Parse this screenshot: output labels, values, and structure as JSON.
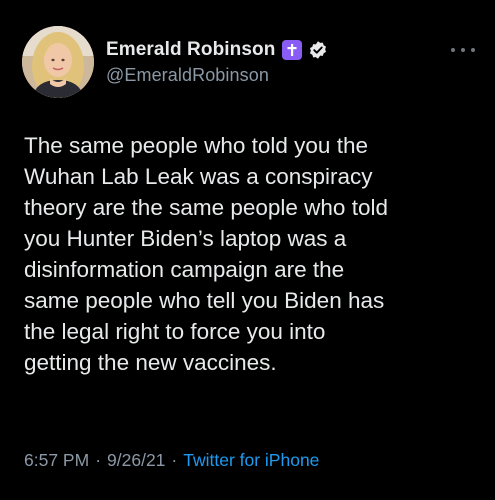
{
  "author": {
    "display_name": "Emerald Robinson",
    "handle": "@EmeraldRobinson",
    "badge_icons": [
      "cross-icon",
      "verified-icon"
    ]
  },
  "tweet": {
    "text": "The same people who told you the\nWuhan Lab Leak was a conspiracy\ntheory are the same people who told\nyou Hunter Biden’s laptop was a\ndisinformation campaign are the\nsame people who tell you Biden has\nthe legal right to force you into\ngetting the new vaccines."
  },
  "meta": {
    "time": "6:57 PM",
    "separator": "·",
    "date": "9/26/21",
    "source": "Twitter for iPhone"
  },
  "colors": {
    "background": "#000000",
    "text": "#e7e9ea",
    "secondary": "#8b98a5",
    "link": "#1d9bf0",
    "badge_purple": "#8a5cf6"
  }
}
